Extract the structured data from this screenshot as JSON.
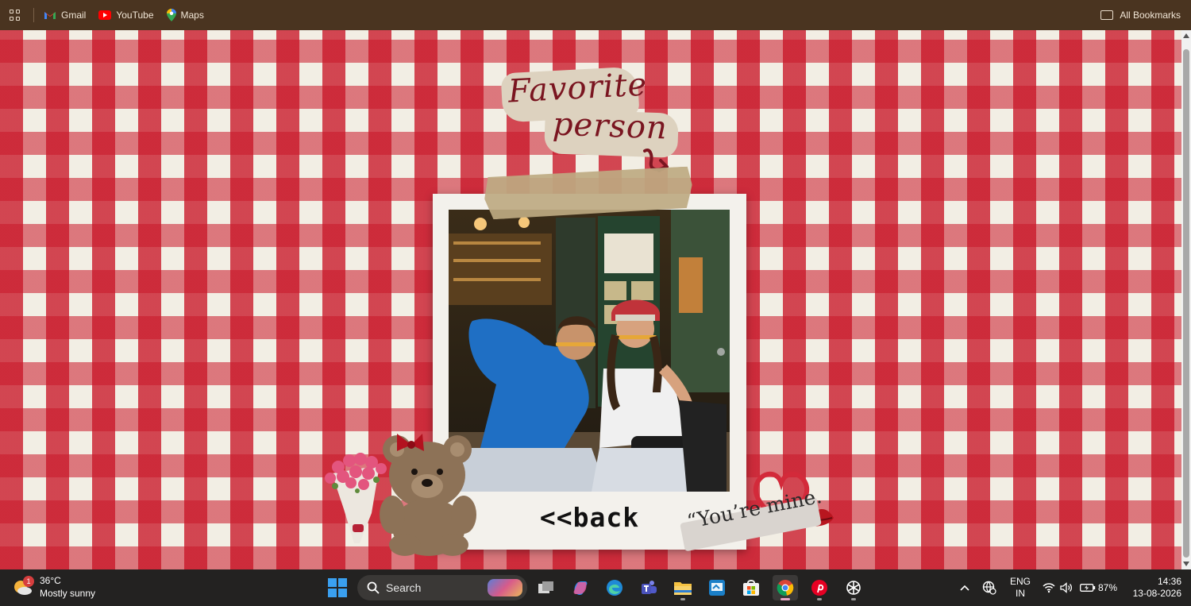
{
  "bookmarks": {
    "items": [
      {
        "label": "Gmail",
        "icon": "gmail-icon"
      },
      {
        "label": "YouTube",
        "icon": "youtube-icon"
      },
      {
        "label": "Maps",
        "icon": "maps-icon"
      }
    ],
    "all_label": "All Bookmarks"
  },
  "page": {
    "title_line1": "Favorite",
    "title_line2": "person",
    "back_label": "<<back",
    "quote": "“You’re mine."
  },
  "taskbar": {
    "weather": {
      "temp": "36°C",
      "desc": "Mostly sunny",
      "badge": "1"
    },
    "search_label": "Search",
    "apps": [
      "task-view",
      "copilot",
      "edge",
      "teams",
      "file-explorer",
      "remote-desktop",
      "microsoft-store",
      "chrome",
      "pinterest",
      "chatgpt"
    ],
    "lang_top": "ENG",
    "lang_bottom": "IN",
    "battery": "87%",
    "time": "14:36",
    "date": "13-08-2026"
  },
  "colors": {
    "bookmark_bar": "#4a3420",
    "gingham_red": "#c91628",
    "title_text": "#7a1520",
    "taskbar": "#232221"
  }
}
